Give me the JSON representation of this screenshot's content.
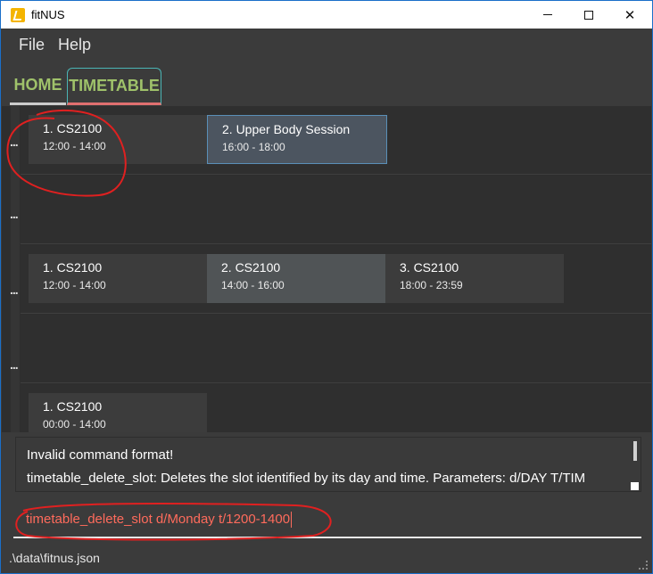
{
  "window": {
    "title": "fitNUS",
    "minimize_glyph": "—",
    "maximize_glyph": "☐",
    "close_glyph": "✕"
  },
  "menu": {
    "items": [
      "File",
      "Help"
    ]
  },
  "tabs": [
    {
      "label": "HOME"
    },
    {
      "label": "TIMETABLE"
    }
  ],
  "timetable": {
    "row_marker": "...",
    "rows": [
      {
        "slots": [
          {
            "title": "1.  CS2100",
            "time": "12:00 - 14:00"
          },
          {
            "title": "2.  Upper Body Session",
            "time": "16:00 - 18:00"
          }
        ]
      },
      {
        "slots": []
      },
      {
        "slots": [
          {
            "title": "1.  CS2100",
            "time": "12:00 - 14:00"
          },
          {
            "title": "2.  CS2100",
            "time": "14:00 - 16:00"
          },
          {
            "title": "3.  CS2100",
            "time": "18:00 - 23:59"
          }
        ]
      },
      {
        "slots": []
      },
      {
        "slots": [
          {
            "title": "1.  CS2100",
            "time": "00:00 - 14:00"
          }
        ]
      }
    ]
  },
  "result": {
    "lines": [
      "Invalid command format!",
      "timetable_delete_slot: Deletes the slot identified by its day and time. Parameters: d/DAY T/TIM"
    ]
  },
  "command": {
    "value": "timetable_delete_slot d/Monday t/1200-1400"
  },
  "status": {
    "path": ".\\data\\fitnus.json"
  },
  "colors": {
    "accent_tab": "#9fc26a",
    "annotation": "#e02020",
    "command_text": "#ff6b5c"
  }
}
